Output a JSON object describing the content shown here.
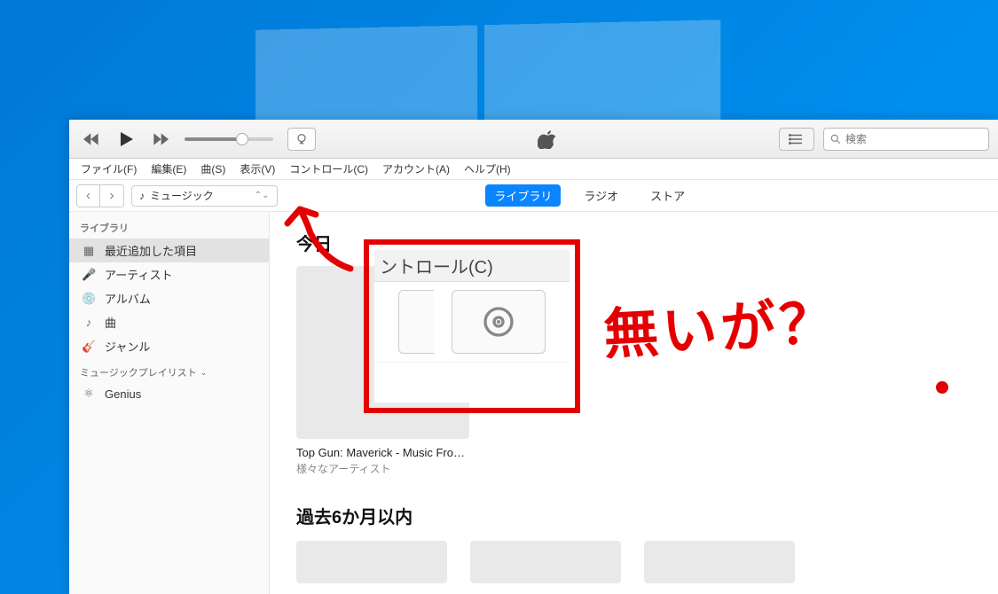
{
  "menu": {
    "file": "ファイル(F)",
    "edit": "編集(E)",
    "song": "曲(S)",
    "view": "表示(V)",
    "control": "コントロール(C)",
    "account": "アカウント(A)",
    "help": "ヘルプ(H)"
  },
  "source_selector": {
    "label": "ミュージック"
  },
  "tabs": {
    "library": "ライブラリ",
    "radio": "ラジオ",
    "store": "ストア"
  },
  "search": {
    "placeholder": "検索"
  },
  "sidebar": {
    "library_header": "ライブラリ",
    "items": [
      {
        "label": "最近追加した項目"
      },
      {
        "label": "アーティスト"
      },
      {
        "label": "アルバム"
      },
      {
        "label": "曲"
      },
      {
        "label": "ジャンル"
      }
    ],
    "playlist_header": "ミュージックプレイリスト",
    "genius": "Genius"
  },
  "content": {
    "section_today": "今日",
    "album1_title": "Top Gun: Maverick - Music Fro…",
    "album1_artist": "様々なアーティスト",
    "section_6mo": "過去6か月以内"
  },
  "annotation": {
    "popup_menu_fragment": "ントロール(C)",
    "handwritten_text": "無いが？"
  }
}
